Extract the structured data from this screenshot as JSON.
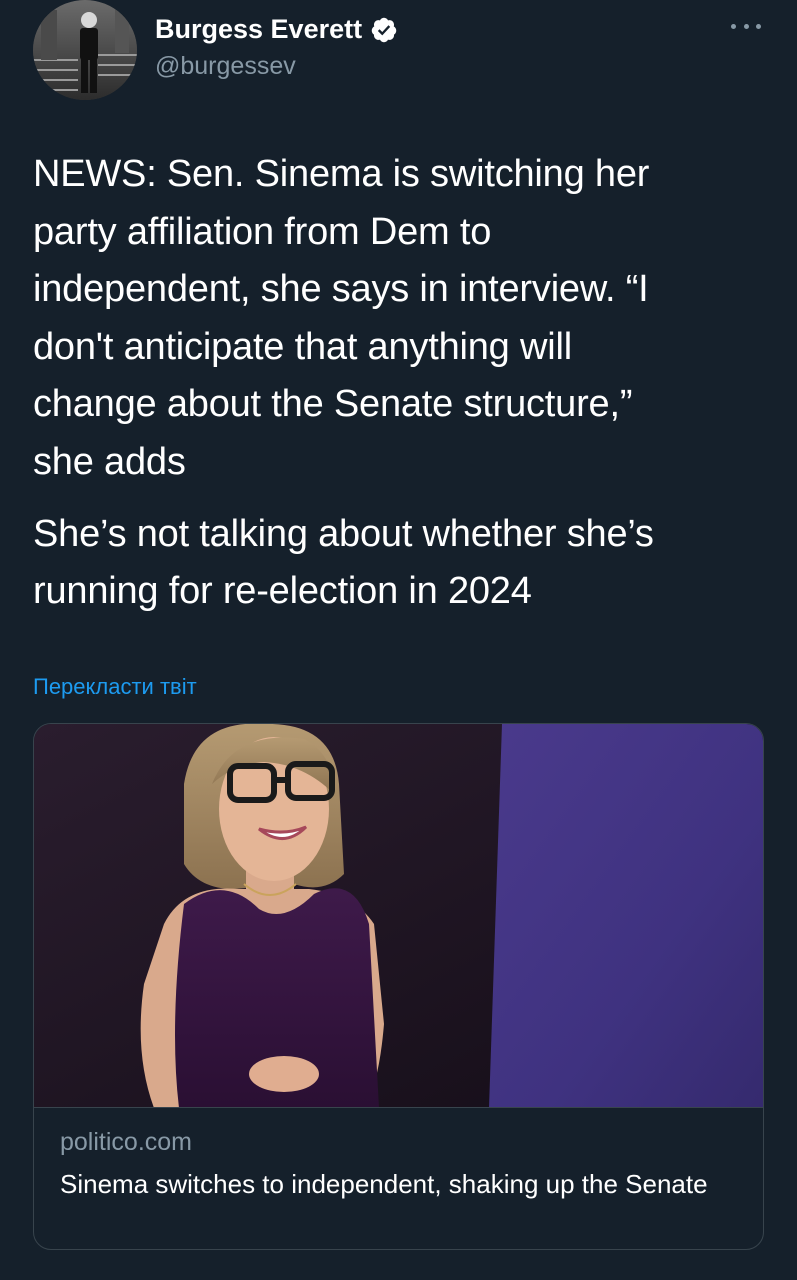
{
  "author": {
    "display_name": "Burgess Everett",
    "handle": "@burgessev",
    "verified": true
  },
  "tweet": {
    "paragraph_1": "NEWS: Sen. Sinema is switching her\nparty affiliation from Dem to\nindependent, she says in interview. “I\ndon't anticipate that anything will\nchange about the Senate structure,”\nshe adds",
    "paragraph_2": "She’s not talking about whether she’s\nrunning for re-election in 2024",
    "translate_label": "Перекласти твіт"
  },
  "link_card": {
    "domain": "politico.com",
    "title": "Sinema switches to independent, shaking up the Senate"
  },
  "icons": {
    "verified": "verified-badge-icon",
    "more": "more-dots-icon"
  },
  "colors": {
    "background": "#15202b",
    "secondary_text": "#8899a6",
    "link": "#1d9bf0",
    "border": "#38444d"
  }
}
